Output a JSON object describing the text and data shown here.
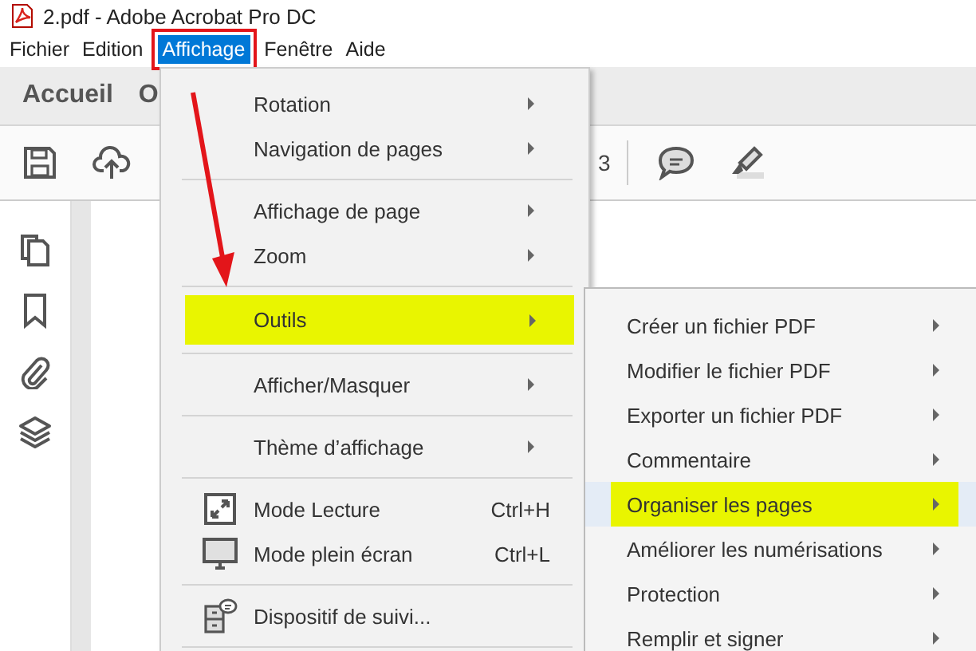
{
  "window": {
    "title": "2.pdf - Adobe Acrobat Pro DC"
  },
  "menu_bar": [
    {
      "label": "Fichier",
      "selected": false
    },
    {
      "label": "Edition",
      "selected": false
    },
    {
      "label": "Affichage",
      "selected": true
    },
    {
      "label": "Fenêtre",
      "selected": false
    },
    {
      "label": "Aide",
      "selected": false
    }
  ],
  "tabs": [
    {
      "label": "Accueil"
    },
    {
      "label": "O"
    }
  ],
  "toolbar": {
    "page_number": "3"
  },
  "view_menu": {
    "items": [
      {
        "kind": "item",
        "label": "Rotation",
        "submenu": true,
        "selected": false
      },
      {
        "kind": "item",
        "label": "Navigation de pages",
        "submenu": true,
        "selected": false
      },
      {
        "kind": "separator"
      },
      {
        "kind": "item",
        "label": "Affichage de page",
        "submenu": true,
        "selected": false
      },
      {
        "kind": "item",
        "label": "Zoom",
        "submenu": true,
        "selected": false
      },
      {
        "kind": "separator"
      },
      {
        "kind": "item",
        "label": "Outils",
        "submenu": true,
        "selected": true
      },
      {
        "kind": "separator"
      },
      {
        "kind": "item",
        "label": "Afficher/Masquer",
        "submenu": true,
        "selected": false
      },
      {
        "kind": "separator"
      },
      {
        "kind": "item",
        "label": "Thème d’affichage",
        "submenu": true,
        "selected": false
      },
      {
        "kind": "separator"
      },
      {
        "kind": "icon_item",
        "label": "Mode Lecture",
        "shortcut": "Ctrl+H",
        "selected": false
      },
      {
        "kind": "icon_item",
        "label": "Mode plein écran",
        "shortcut": "Ctrl+L",
        "selected": false
      },
      {
        "kind": "separator"
      },
      {
        "kind": "icon_item",
        "label": "Dispositif de suivi...",
        "selected": false
      },
      {
        "kind": "separator"
      }
    ]
  },
  "tools_submenu": {
    "items": [
      {
        "label": "Créer un fichier PDF",
        "submenu": true,
        "selected": false
      },
      {
        "label": "Modifier le fichier PDF",
        "submenu": true,
        "selected": false
      },
      {
        "label": "Exporter un fichier PDF",
        "submenu": true,
        "selected": false
      },
      {
        "label": "Commentaire",
        "submenu": true,
        "selected": false
      },
      {
        "label": "Organiser les pages",
        "submenu": true,
        "selected": true
      },
      {
        "label": "Améliorer les numérisations",
        "submenu": true,
        "selected": false
      },
      {
        "label": "Protection",
        "submenu": true,
        "selected": false
      },
      {
        "label": "Remplir et signer",
        "submenu": true,
        "selected": false
      }
    ]
  }
}
